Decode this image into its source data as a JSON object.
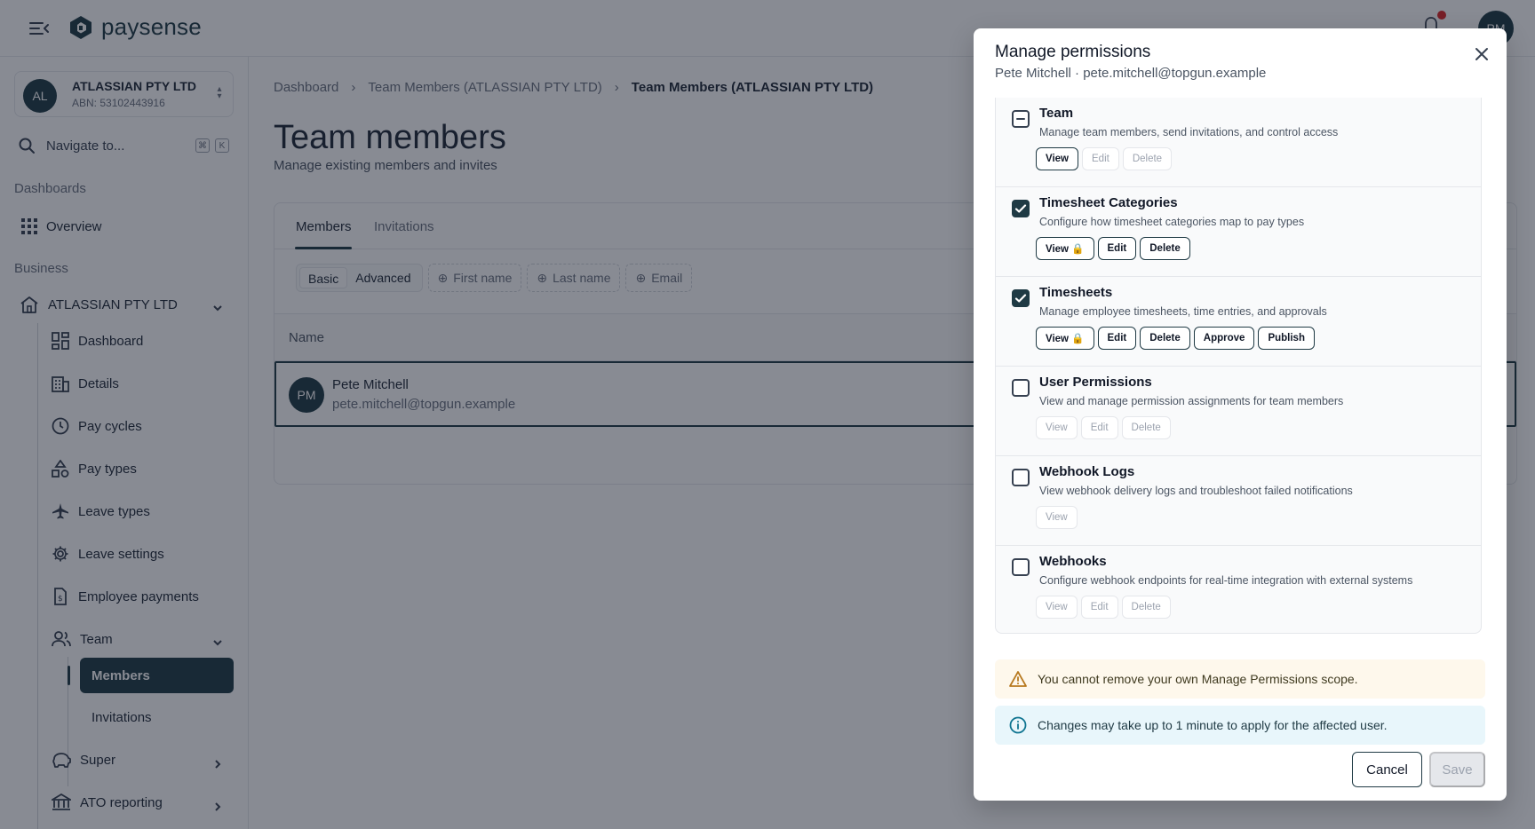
{
  "app": {
    "brand": "paysense",
    "user_initials": "PM",
    "colors": {
      "primary": "#1f3a44",
      "notification": "#dc2626",
      "warning_bg": "#fef8ec",
      "info_bg": "#e8f6fb"
    }
  },
  "sidebar": {
    "org": {
      "initials": "AL",
      "name": "ATLASSIAN PTY LTD",
      "abn": "ABN: 53102443916"
    },
    "search": {
      "label": "Navigate to...",
      "shortcut": [
        "⌘",
        "K"
      ]
    },
    "sections": {
      "dashboards": "Dashboards",
      "business": "Business"
    },
    "overview": "Overview",
    "business_name": "ATLASSIAN PTY LTD",
    "items": {
      "dashboard": "Dashboard",
      "details": "Details",
      "pay_cycles": "Pay cycles",
      "pay_types": "Pay types",
      "leave_types": "Leave types",
      "leave_settings": "Leave settings",
      "employee_payments": "Employee payments",
      "team": "Team",
      "members": "Members",
      "invitations": "Invitations",
      "super": "Super",
      "ato_reporting": "ATO reporting"
    }
  },
  "main": {
    "breadcrumb": [
      "Dashboard",
      "Team Members (ATLASSIAN PTY LTD)",
      "Team Members (ATLASSIAN PTY LTD)"
    ],
    "title": "Team members",
    "subtitle": "Manage existing members and invites",
    "tabs": [
      "Members",
      "Invitations"
    ],
    "filter_modes": [
      "Basic",
      "Advanced"
    ],
    "filters": [
      "First name",
      "Last name",
      "Email"
    ],
    "table": {
      "columns": [
        "Name"
      ],
      "rows": [
        {
          "initials": "PM",
          "name": "Pete Mitchell",
          "email": "pete.mitchell@topgun.example"
        }
      ]
    }
  },
  "modal": {
    "title": "Manage permissions",
    "subtitle": "Pete Mitchell · pete.mitchell@topgun.example",
    "permissions": [
      {
        "name": "Team",
        "state": "indeterminate",
        "description": "Manage team members, send invitations, and control access",
        "buttons": [
          {
            "label": "View",
            "on": true
          },
          {
            "label": "Edit",
            "on": false
          },
          {
            "label": "Delete",
            "on": false
          }
        ]
      },
      {
        "name": "Timesheet Categories",
        "state": "checked",
        "description": "Configure how timesheet categories map to pay types",
        "buttons": [
          {
            "label": "View 🔒",
            "on": true
          },
          {
            "label": "Edit",
            "on": true
          },
          {
            "label": "Delete",
            "on": true
          }
        ]
      },
      {
        "name": "Timesheets",
        "state": "checked",
        "description": "Manage employee timesheets, time entries, and approvals",
        "buttons": [
          {
            "label": "View 🔒",
            "on": true
          },
          {
            "label": "Edit",
            "on": true
          },
          {
            "label": "Delete",
            "on": true
          },
          {
            "label": "Approve",
            "on": true
          },
          {
            "label": "Publish",
            "on": true
          }
        ]
      },
      {
        "name": "User Permissions",
        "state": "unchecked",
        "description": "View and manage permission assignments for team members",
        "buttons": [
          {
            "label": "View",
            "on": false
          },
          {
            "label": "Edit",
            "on": false
          },
          {
            "label": "Delete",
            "on": false
          }
        ]
      },
      {
        "name": "Webhook Logs",
        "state": "unchecked",
        "description": "View webhook delivery logs and troubleshoot failed notifications",
        "buttons": [
          {
            "label": "View",
            "on": false
          }
        ]
      },
      {
        "name": "Webhooks",
        "state": "unchecked",
        "description": "Configure webhook endpoints for real-time integration with external systems",
        "buttons": [
          {
            "label": "View",
            "on": false
          },
          {
            "label": "Edit",
            "on": false
          },
          {
            "label": "Delete",
            "on": false
          }
        ]
      }
    ],
    "warning": "You cannot remove your own Manage Permissions scope.",
    "info": "Changes may take up to 1 minute to apply for the affected user.",
    "cancel_label": "Cancel",
    "save_label": "Save"
  }
}
